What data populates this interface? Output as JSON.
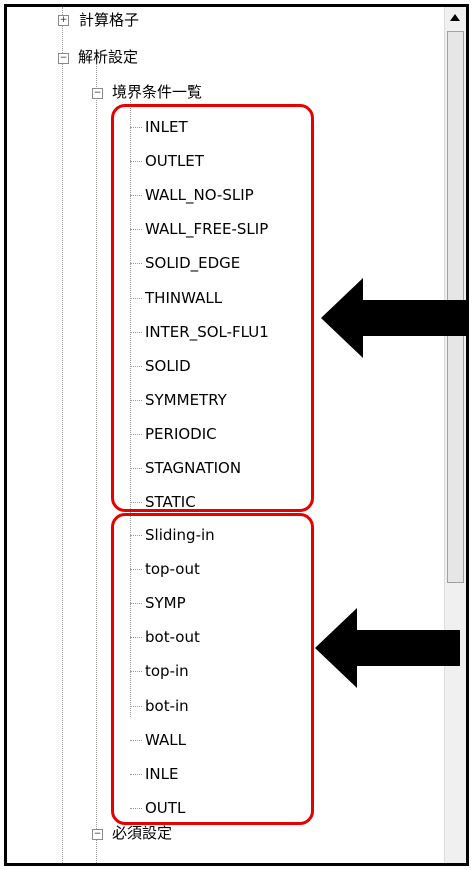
{
  "tree": {
    "root_items": [
      {
        "label": "計算格子",
        "state": "expanded"
      },
      {
        "label": "解析設定",
        "state": "expanded"
      }
    ],
    "boundary_group": {
      "label": "境界条件一覧",
      "state": "expanded"
    },
    "standard_conditions": [
      "INLET",
      "OUTLET",
      "WALL_NO-SLIP",
      "WALL_FREE-SLIP",
      "SOLID_EDGE",
      "THINWALL",
      "INTER_SOL-FLU1",
      "SOLID",
      "SYMMETRY",
      "PERIODIC",
      "STAGNATION",
      "STATIC"
    ],
    "user_conditions": [
      "Sliding-in",
      "top-out",
      "SYMP",
      "bot-out",
      "top-in",
      "bot-in",
      "WALL",
      "INLE",
      "OUTL"
    ],
    "required_settings": {
      "label": "必須設定",
      "state": "expanded"
    }
  },
  "colors": {
    "highlight": "#e60000",
    "arrow": "#000000"
  },
  "icons": {
    "collapse": "minus-box-icon",
    "expand": "plus-box-icon",
    "scroll_up": "triangle-up-icon"
  }
}
